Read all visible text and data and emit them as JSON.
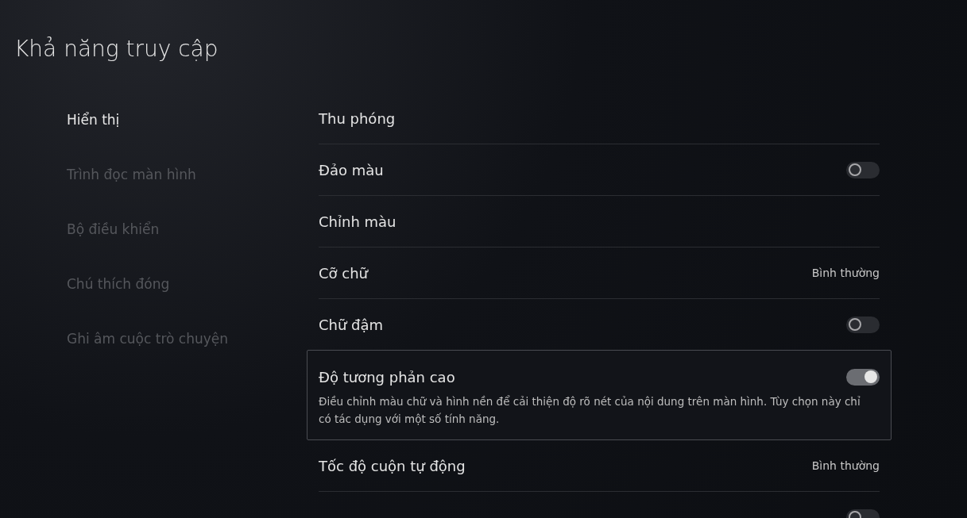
{
  "title": "Khả năng truy cập",
  "sidebar": {
    "items": [
      {
        "label": "Hiển thị",
        "selected": true
      },
      {
        "label": "Trình đọc màn hình",
        "selected": false
      },
      {
        "label": "Bộ điều khiển",
        "selected": false
      },
      {
        "label": "Chú thích đóng",
        "selected": false
      },
      {
        "label": "Ghi âm cuộc trò chuyện",
        "selected": false
      }
    ]
  },
  "settings": [
    {
      "kind": "link",
      "label": "Thu phóng",
      "focused": false
    },
    {
      "kind": "toggle",
      "label": "Đảo màu",
      "on": false,
      "focused": false
    },
    {
      "kind": "link",
      "label": "Chỉnh màu",
      "focused": false
    },
    {
      "kind": "value",
      "label": "Cỡ chữ",
      "value": "Bình thường",
      "focused": false
    },
    {
      "kind": "toggle",
      "label": "Chữ đậm",
      "on": false,
      "focused": false
    },
    {
      "kind": "toggle",
      "label": "Độ tương phản cao",
      "on": true,
      "focused": true,
      "description": "Điều chỉnh màu chữ và hình nền để cải thiện độ rõ nét của nội dung trên màn hình. Tùy chọn này chỉ có tác dụng với một số tính năng."
    },
    {
      "kind": "value",
      "label": "Tốc độ cuộn tự động",
      "value": "Bình thường",
      "focused": false
    },
    {
      "kind": "toggle",
      "on": false,
      "focused": false
    }
  ]
}
